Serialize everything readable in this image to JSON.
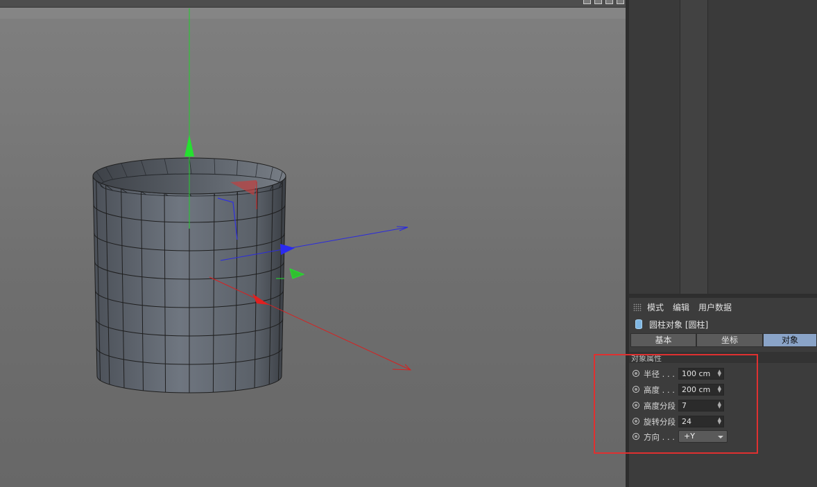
{
  "attributes": {
    "menu": [
      "模式",
      "编辑",
      "用户数据"
    ],
    "object_title": "圆柱对象 [圆柱]",
    "tabs": [
      {
        "label": "基本",
        "active": false
      },
      {
        "label": "坐标",
        "active": false
      },
      {
        "label": "对象",
        "active": true
      }
    ],
    "section_title": "对象属性",
    "params": [
      {
        "label": "半径 . . .",
        "value": "100 cm"
      },
      {
        "label": "高度 . . .",
        "value": "200 cm"
      },
      {
        "label": "高度分段",
        "value": "7"
      },
      {
        "label": "旋转分段",
        "value": "24"
      },
      {
        "label": "方向 . . .",
        "value": "+Y"
      }
    ]
  },
  "scene": {
    "object": "cylinder",
    "height_segments": 7,
    "rotation_segments": 24
  },
  "colors": {
    "x_axis": "#e02020",
    "y_axis": "#20d020",
    "z_axis": "#2030e0",
    "highlight": "#e03030",
    "active_tab": "#8aa4c8"
  }
}
